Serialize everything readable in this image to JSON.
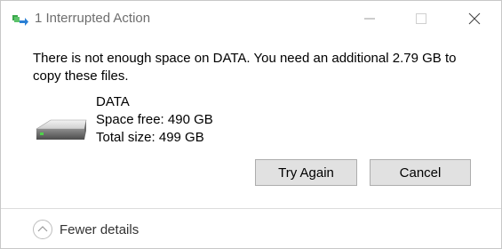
{
  "window": {
    "title": "1 Interrupted Action"
  },
  "dialog": {
    "message": "There is not enough space on DATA. You need an additional 2.79 GB to copy these files."
  },
  "drive": {
    "icon": "hard-drive-icon",
    "name": "DATA",
    "space_free": "Space free: 490 GB",
    "total_size": "Total size: 499 GB"
  },
  "buttons": {
    "try_again": "Try Again",
    "cancel": "Cancel"
  },
  "footer": {
    "details_label": "Fewer details",
    "details_icon": "chevron-up-icon"
  },
  "colors": {
    "button_bg": "#e1e1e1",
    "button_border": "#adadad",
    "title_text": "#6e6e6e"
  }
}
